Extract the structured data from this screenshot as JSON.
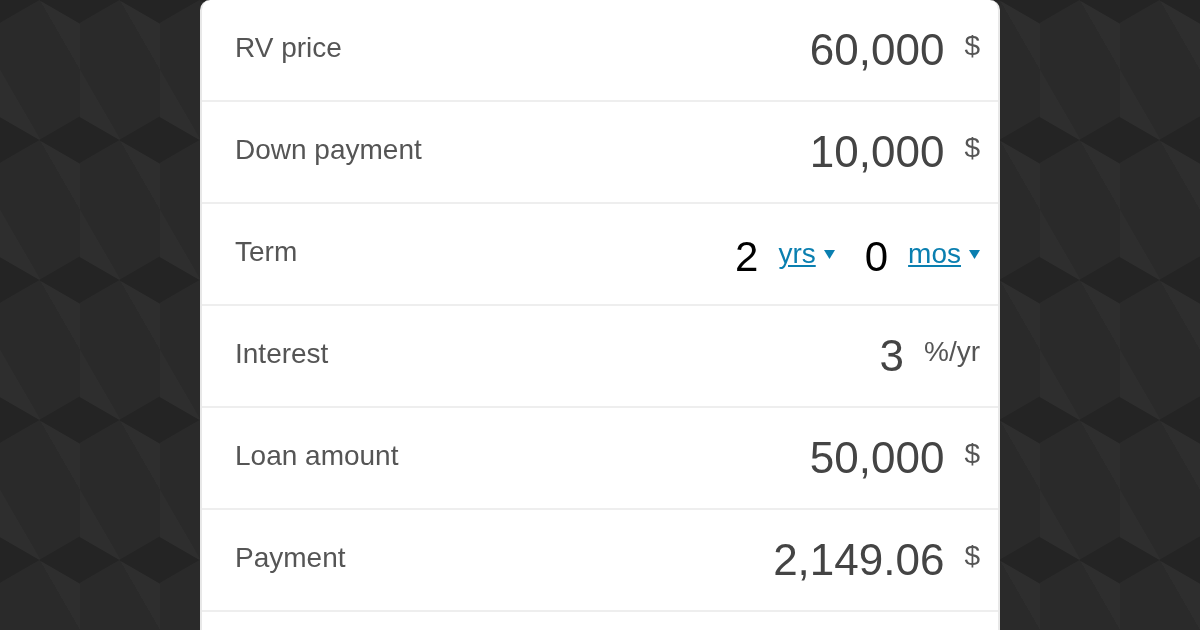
{
  "rows": [
    {
      "kind": "amount",
      "label": "RV price",
      "value": "60,000",
      "unit": "$"
    },
    {
      "kind": "amount",
      "label": "Down payment",
      "value": "10,000",
      "unit": "$"
    },
    {
      "kind": "term",
      "label": "Term",
      "years": "2",
      "years_unit": "yrs",
      "months": "0",
      "months_unit": "mos"
    },
    {
      "kind": "amount",
      "label": "Interest",
      "value": "3",
      "unit": "%/yr"
    },
    {
      "kind": "amount",
      "label": "Loan amount",
      "value": "50,000",
      "unit": "$"
    },
    {
      "kind": "amount",
      "label": "Payment",
      "value": "2,149.06",
      "unit": "$"
    }
  ]
}
